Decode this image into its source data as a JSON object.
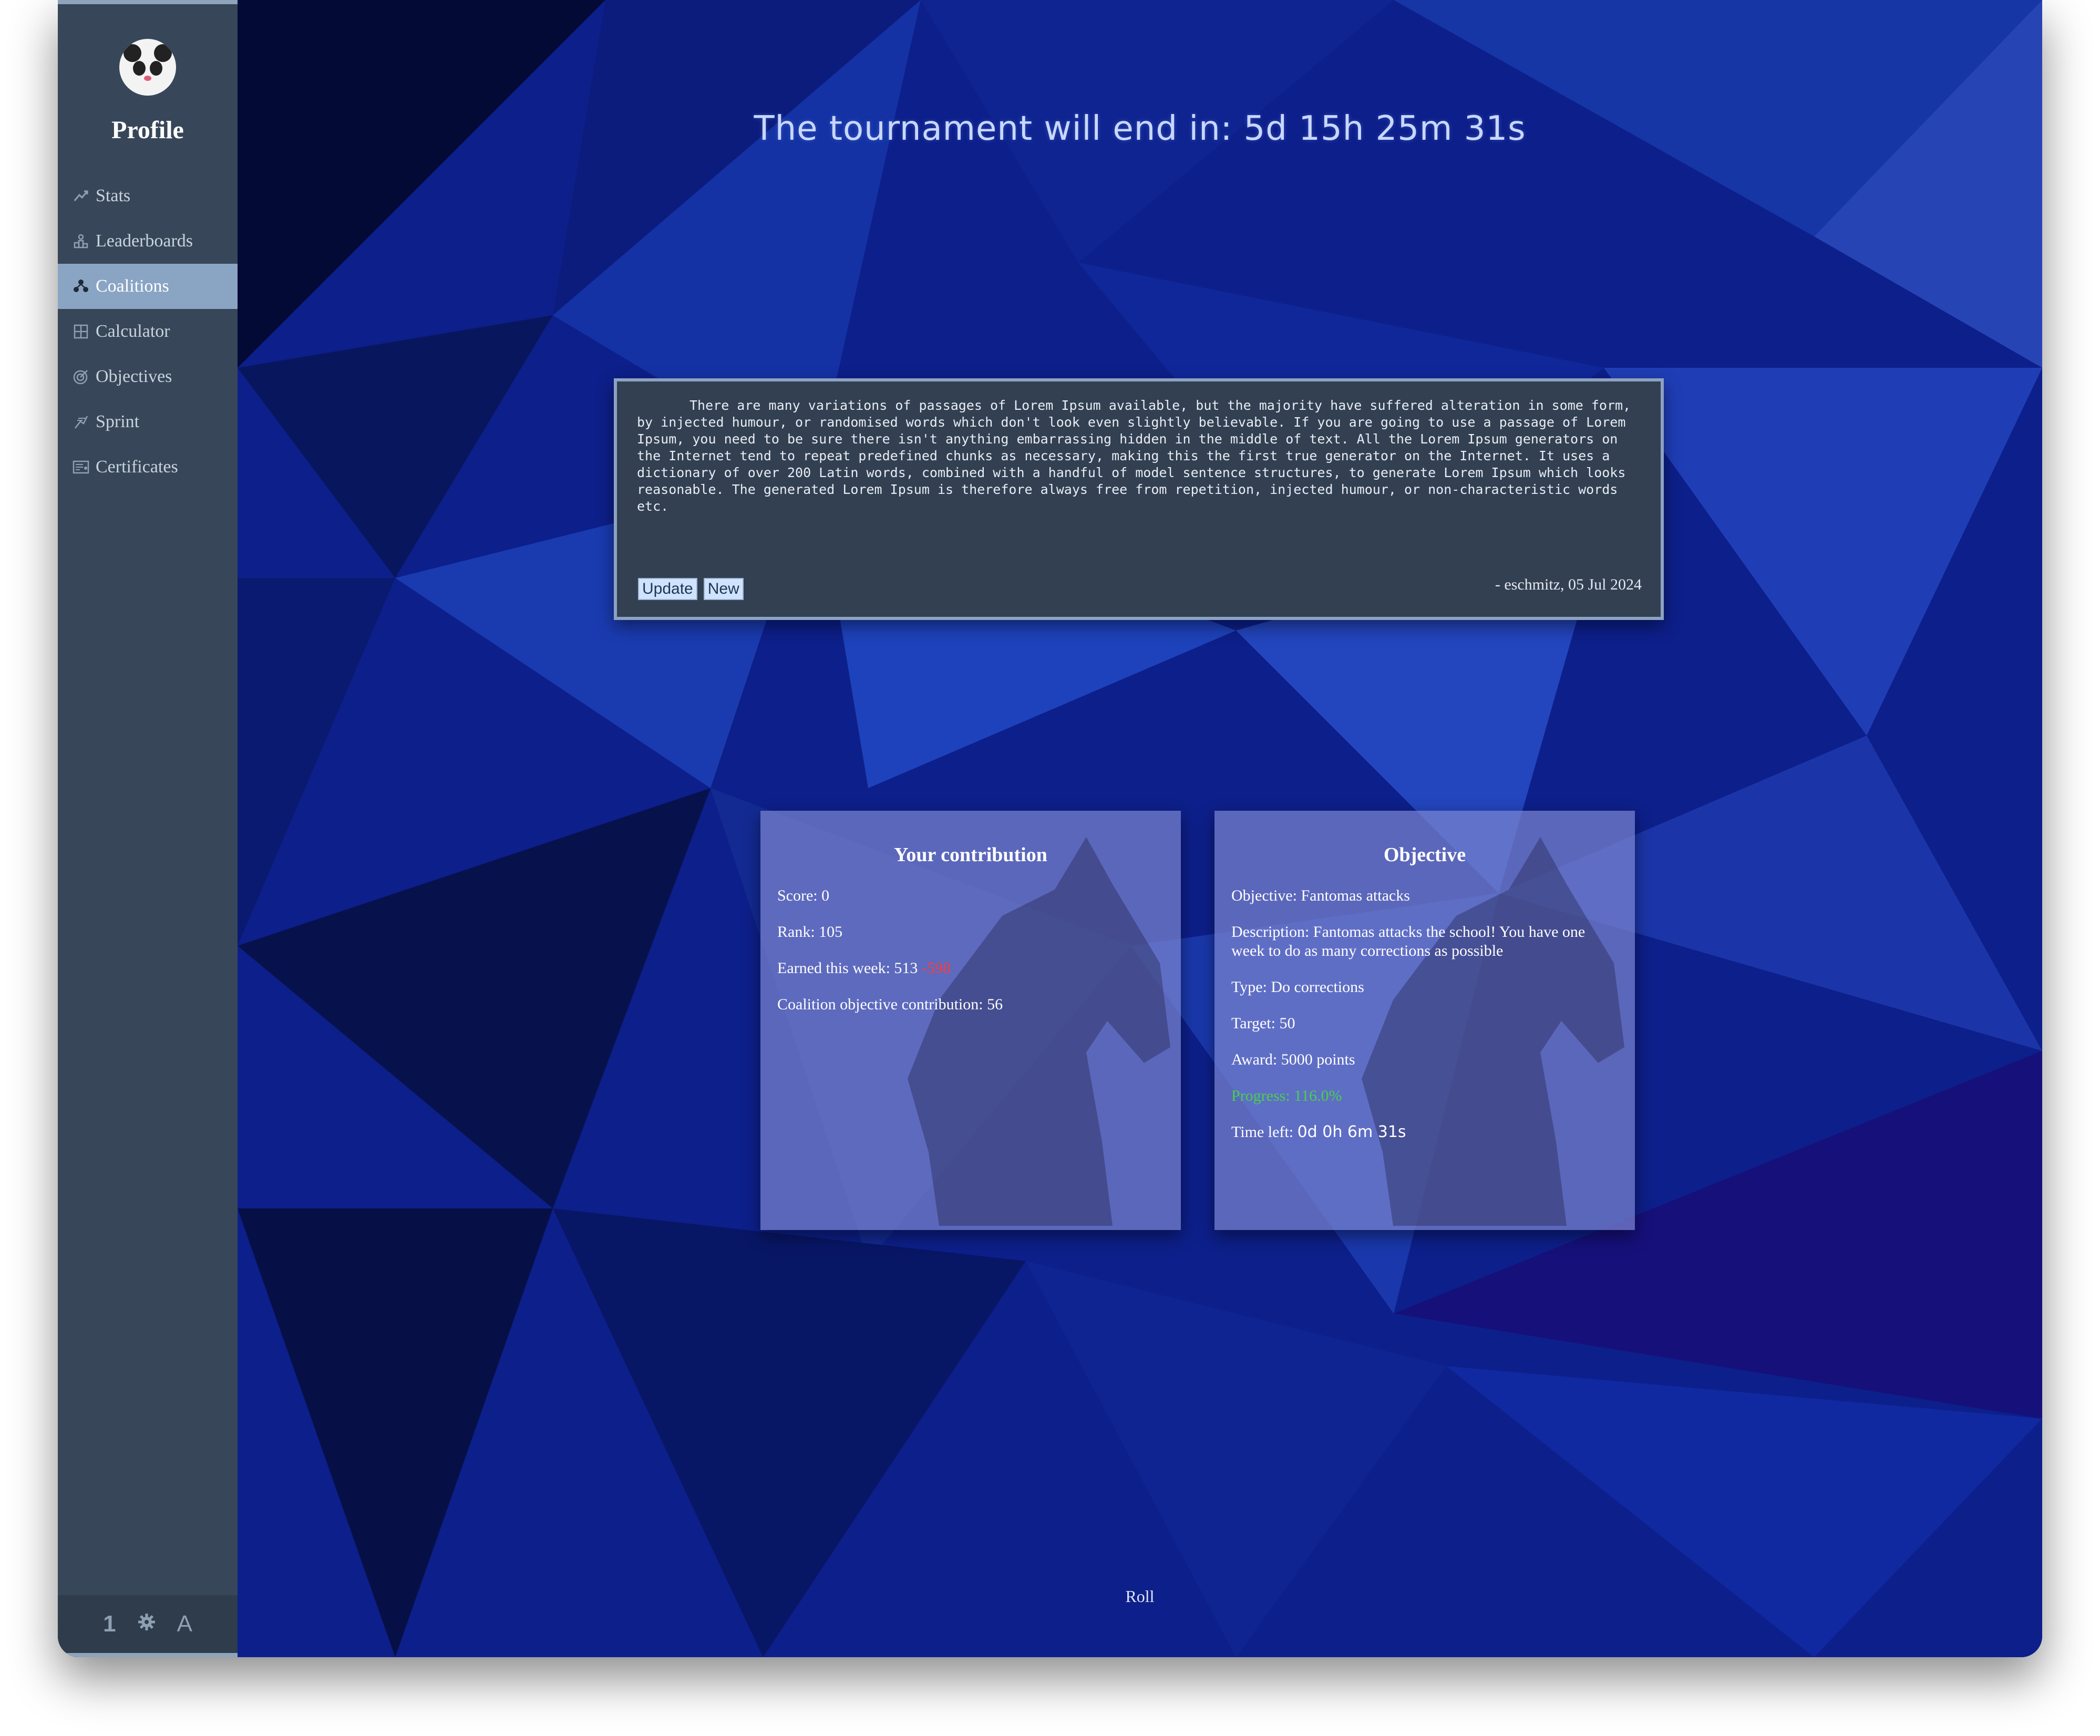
{
  "sidebar": {
    "title": "Profile",
    "items": [
      {
        "label": "Stats",
        "icon": "stats-icon",
        "active": false
      },
      {
        "label": "Leaderboards",
        "icon": "leaderboard-icon",
        "active": false
      },
      {
        "label": "Coalitions",
        "icon": "coalitions-icon",
        "active": true
      },
      {
        "label": "Calculator",
        "icon": "calculator-icon",
        "active": false
      },
      {
        "label": "Objectives",
        "icon": "target-icon",
        "active": false
      },
      {
        "label": "Sprint",
        "icon": "sprint-icon",
        "active": false
      },
      {
        "label": "Certificates",
        "icon": "certificate-icon",
        "active": false
      }
    ],
    "footer": {
      "logo_text": "1",
      "settings_icon": "gear-icon",
      "font_toggle": "A"
    }
  },
  "main": {
    "headline": "The tournament will end in:  5d 15h 25m 31s",
    "note": {
      "text": "There are many variations of passages of Lorem Ipsum available, but the majority have suffered alteration in some form, by injected humour, or randomised words which don't look even slightly believable. If you are going to use a passage of Lorem Ipsum, you need to be sure there isn't anything embarrassing hidden in the middle of text. All the Lorem Ipsum generators on the Internet tend to repeat predefined chunks as necessary, making this the first true generator on the Internet. It uses a dictionary of over 200 Latin words, combined with a handful of model sentence structures, to generate Lorem Ipsum which looks reasonable. The generated Lorem Ipsum is therefore always free from repetition, injected humour, or non-characteristic words etc.",
      "update_label": "Update",
      "new_label": "New",
      "signature": "- eschmitz, 05 Jul 2024"
    },
    "contribution": {
      "title": "Your contribution",
      "score": "Score: 0",
      "rank": "Rank: 105",
      "earned": "Earned this week: 513",
      "earned_delta": "-598",
      "coalition_contribution": "Coalition objective contribution: 56"
    },
    "objective": {
      "title": "Objective",
      "name": "Objective: Fantomas attacks",
      "description": "Description: Fantomas attacks the school! You have one week to do as many corrections as possible",
      "type": "Type: Do corrections",
      "target": "Target: 50",
      "award": "Award: 5000 points",
      "progress": "Progress: 116.0%",
      "time_left_label": "Time left:",
      "time_left_value": "0d 0h 6m 31s"
    },
    "roll_label": "Roll"
  },
  "colors": {
    "sidebar_bg": "#374759",
    "sidebar_active": "#8aa5c4",
    "background_primary": "#0d1f8a",
    "negative": "#ff3b3b",
    "positive": "#45d24a"
  }
}
